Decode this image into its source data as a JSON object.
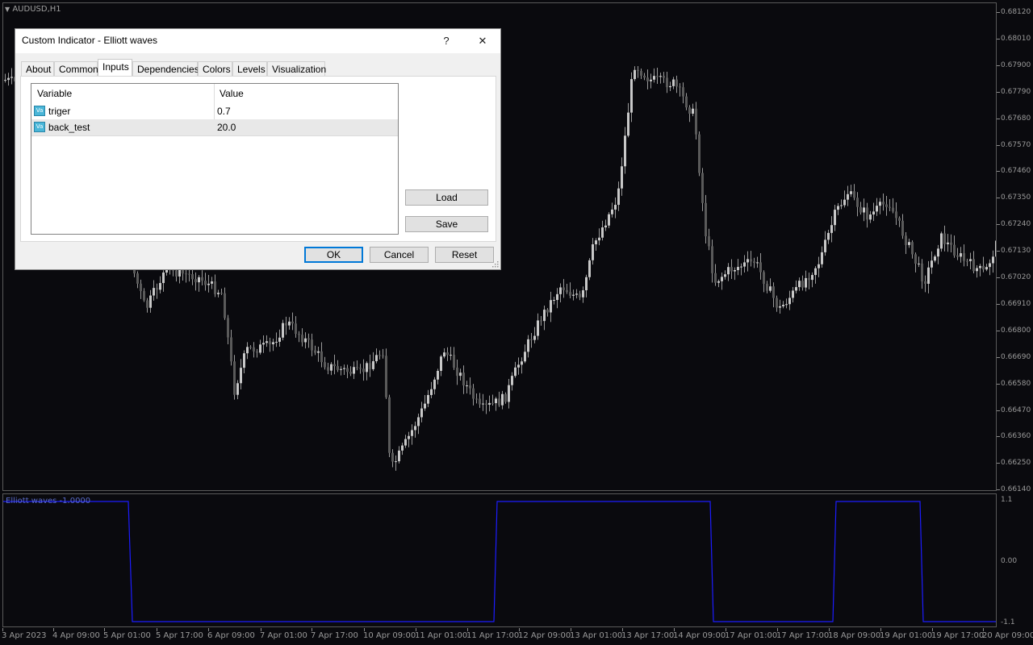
{
  "main_chart": {
    "title": "AUDUSD,H1",
    "price_labels": [
      "0.68120",
      "0.68010",
      "0.67900",
      "0.67790",
      "0.67680",
      "0.67570",
      "0.67460",
      "0.67350",
      "0.67240",
      "0.67130",
      "0.67020",
      "0.66910",
      "0.66800",
      "0.66690",
      "0.66580",
      "0.66470",
      "0.66360",
      "0.66250",
      "0.66140"
    ]
  },
  "indicator": {
    "title": "Elliott waves -1.0000",
    "levels": [
      "1.1",
      "0.00",
      "-1.1"
    ],
    "line_color": "#1c1cff"
  },
  "time_axis": [
    "3 Apr 2023",
    "4 Apr 09:00",
    "5 Apr 01:00",
    "5 Apr 17:00",
    "6 Apr 09:00",
    "7 Apr 01:00",
    "7 Apr 17:00",
    "10 Apr 09:00",
    "11 Apr 01:00",
    "11 Apr 17:00",
    "12 Apr 09:00",
    "13 Apr 01:00",
    "13 Apr 17:00",
    "14 Apr 09:00",
    "17 Apr 01:00",
    "17 Apr 17:00",
    "18 Apr 09:00",
    "19 Apr 01:00",
    "19 Apr 17:00",
    "20 Apr 09:00"
  ],
  "dialog": {
    "title": "Custom Indicator - Elliott waves",
    "help": "?",
    "close": "✕",
    "tabs": [
      "About",
      "Common",
      "Inputs",
      "Dependencies",
      "Colors",
      "Levels",
      "Visualization"
    ],
    "active_tab": "Inputs",
    "grid": {
      "headers": [
        "Variable",
        "Value"
      ],
      "rows": [
        {
          "variable": "triger",
          "value": "0.7"
        },
        {
          "variable": "back_test",
          "value": "20.0"
        }
      ],
      "icon_text": "Va"
    },
    "load": "Load",
    "save": "Save",
    "ok": "OK",
    "cancel": "Cancel",
    "reset": "Reset"
  }
}
